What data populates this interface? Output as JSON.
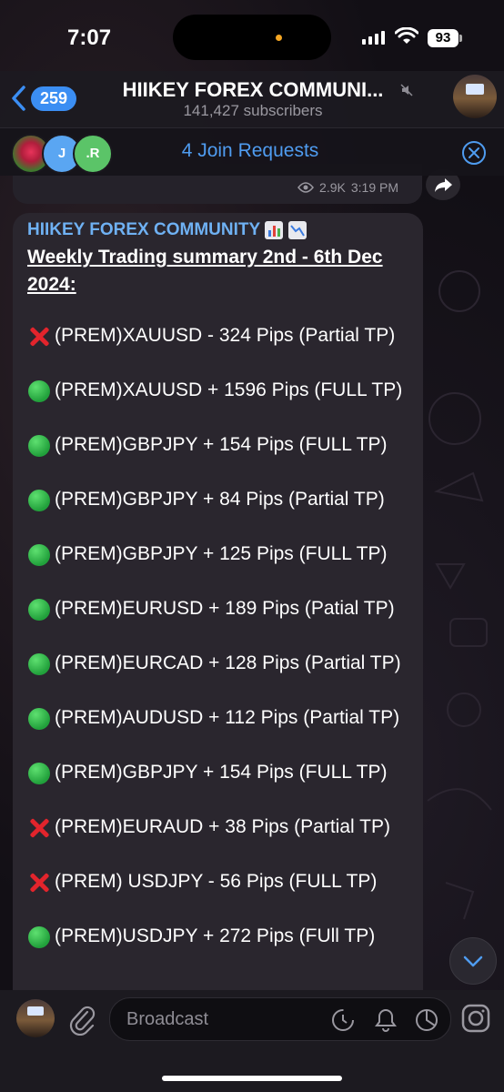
{
  "status_bar": {
    "time": "7:07",
    "battery": "93"
  },
  "header": {
    "back_count": "259",
    "title": "HIIKEY FOREX COMMUNI...",
    "subtitle": "141,427 subscribers"
  },
  "join_bar": {
    "avatars": [
      "J",
      ".R"
    ],
    "label": "4 Join Requests"
  },
  "previous_post": {
    "views": "2.9K",
    "time": "3:19 PM"
  },
  "message": {
    "channel": "HIIKEY FOREX COMMUNITY",
    "title": "Weekly Trading summary 2nd - 6th Dec 2024:",
    "rows": [
      {
        "status": "loss",
        "text": "(PREM)XAUUSD  - 324 Pips  (Partial TP)"
      },
      {
        "status": "win",
        "text": "(PREM)XAUUSD + 1596 Pips  (FULL TP)"
      },
      {
        "status": "win",
        "text": "(PREM)GBPJPY + 154 Pips  (FULL TP)"
      },
      {
        "status": "win",
        "text": "(PREM)GBPJPY + 84 Pips  (Partial TP)"
      },
      {
        "status": "win",
        "text": "(PREM)GBPJPY + 125 Pips  (FULL TP)"
      },
      {
        "status": "win",
        "text": "(PREM)EURUSD  + 189 Pips  (Patial TP)"
      },
      {
        "status": "win",
        "text": "(PREM)EURCAD  + 128 Pips  (Partial TP)"
      },
      {
        "status": "win",
        "text": "(PREM)AUDUSD + 112 Pips  (Partial TP)"
      },
      {
        "status": "win",
        "text": "(PREM)GBPJPY + 154 Pips  (FULL TP)"
      },
      {
        "status": "loss",
        "text": "(PREM)EURAUD + 38 Pips  (Partial TP)"
      },
      {
        "status": "loss",
        "text": "(PREM) USDJPY - 56 Pips  (FULL TP)"
      },
      {
        "status": "win",
        "text": "(PREM)USDJPY + 272 Pips  (FUll TP)"
      }
    ]
  },
  "bottom_bar": {
    "placeholder": "Broadcast"
  },
  "colors": {
    "accent": "#4f9cf0",
    "win": "#21a03b",
    "loss": "#e2242c",
    "bubble": "#2a262e"
  }
}
